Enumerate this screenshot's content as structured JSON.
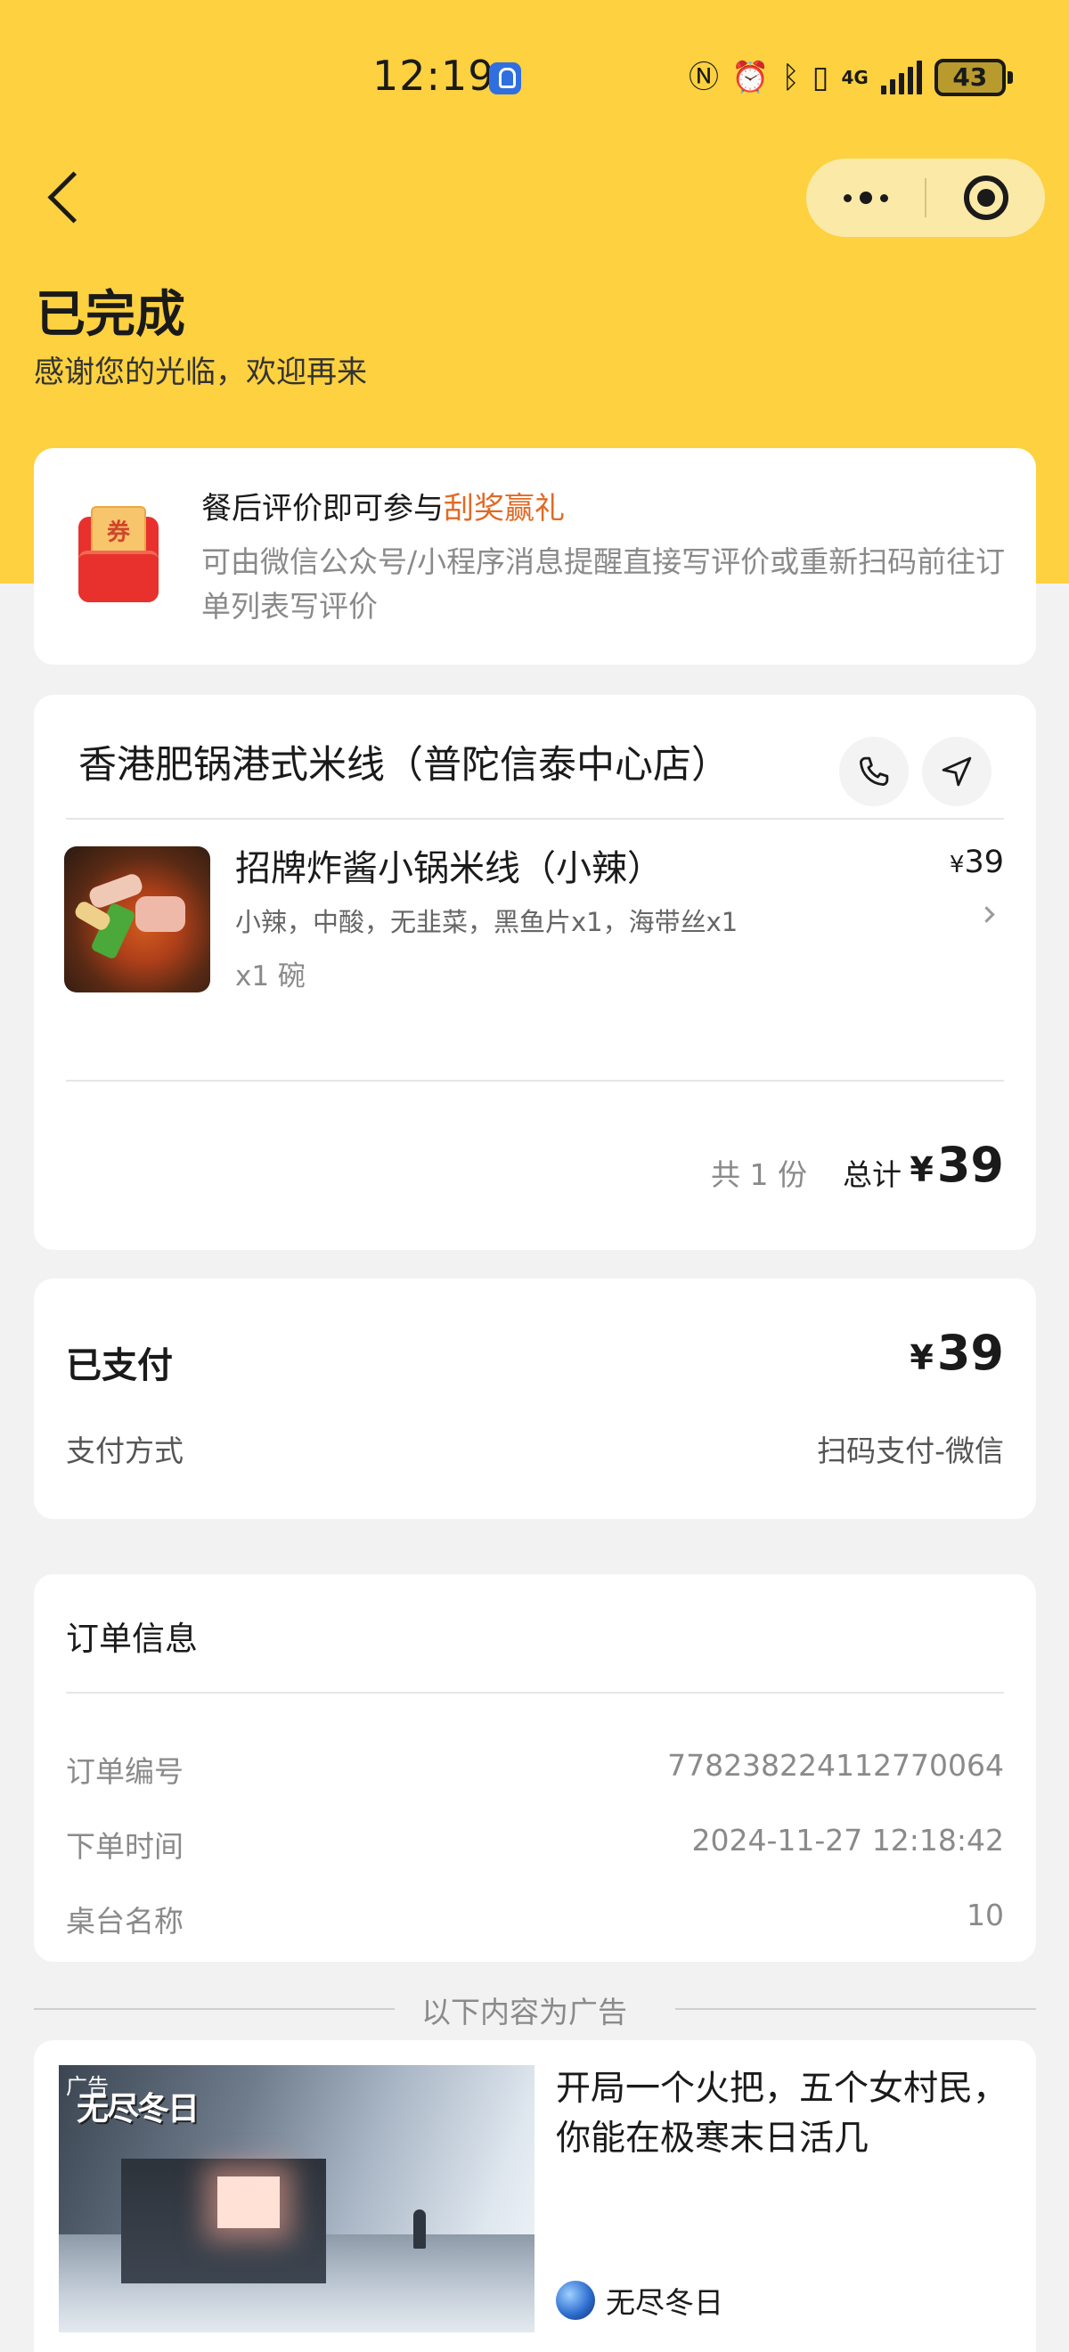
{
  "status_bar": {
    "time": "12:19",
    "battery": "43",
    "network": "4G"
  },
  "header": {
    "title": "已完成",
    "subtitle": "感谢您的光临，欢迎再来"
  },
  "promo": {
    "title_prefix": "餐后评价即可参与",
    "title_highlight": "刮奖赢礼",
    "description": "可由微信公众号/小程序消息提醒直接写评价或重新扫码前往订单列表写评价",
    "icon_text": "券",
    "highlight_color": "#e06a25"
  },
  "shop": {
    "name": "香港肥锅港式米线（普陀信泰中心店）",
    "item": {
      "name": "招牌炸酱小锅米线（小辣）",
      "spec": "小辣，中酸，无韭菜，黑鱼片x1，海带丝x1",
      "qty": "x1 碗",
      "currency": "¥",
      "price": "39"
    },
    "count": "共 1 份",
    "total_label": "总计",
    "total_currency": "¥",
    "total": "39"
  },
  "payment": {
    "label": "已支付",
    "currency": "¥",
    "amount": "39",
    "method_label": "支付方式",
    "method": "扫码支付-微信"
  },
  "order_info": {
    "title": "订单信息",
    "rows": [
      {
        "label": "订单编号",
        "value": "778238224112770064"
      },
      {
        "label": "下单时间",
        "value": "2024-11-27 12:18:42"
      },
      {
        "label": "桌台名称",
        "value": "10"
      }
    ]
  },
  "ad": {
    "divider": "以下内容为广告",
    "tag": "广告",
    "logo": "无尽冬日",
    "title": "开局一个火把，五个女村民，你能在极寒末日活几",
    "source": "无尽冬日"
  },
  "colors": {
    "header_yellow": "#fdd13f",
    "capsule": "#fbe9a8",
    "background": "#f2f2f2"
  }
}
